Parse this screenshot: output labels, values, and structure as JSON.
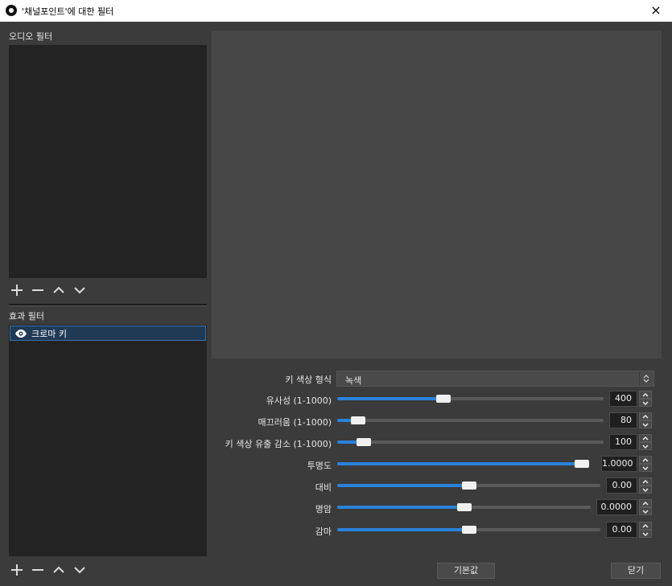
{
  "window": {
    "title": "'채널포인트'에 대한 필터",
    "close_icon": "×"
  },
  "audio_filters": {
    "label": "오디오 필터"
  },
  "effect_filters": {
    "label": "효과 필터",
    "items": [
      {
        "name": "크로마 키"
      }
    ]
  },
  "properties": {
    "key_color_type": {
      "label": "키 색상 형식",
      "value": "녹색"
    },
    "similarity": {
      "label": "유사성 (1-1000)",
      "value": "400",
      "level": 0.4
    },
    "smoothness": {
      "label": "매끄러움 (1-1000)",
      "value": "80",
      "level": 0.08
    },
    "spill_reduction": {
      "label": "키 색상 유출 감소 (1-1000)",
      "value": "100",
      "level": 0.1
    },
    "opacity": {
      "label": "투명도",
      "value": "1.0000",
      "level": 1.0
    },
    "contrast": {
      "label": "대비",
      "value": "0.00",
      "level": 0.5
    },
    "brightness": {
      "label": "명암",
      "value": "0.0000",
      "level": 0.5
    },
    "gamma": {
      "label": "감마",
      "value": "0.00",
      "level": 0.5
    }
  },
  "buttons": {
    "defaults": "기본값",
    "close": "닫기"
  },
  "colors": {
    "accent": "#2a82da",
    "selection": "#203a56"
  }
}
